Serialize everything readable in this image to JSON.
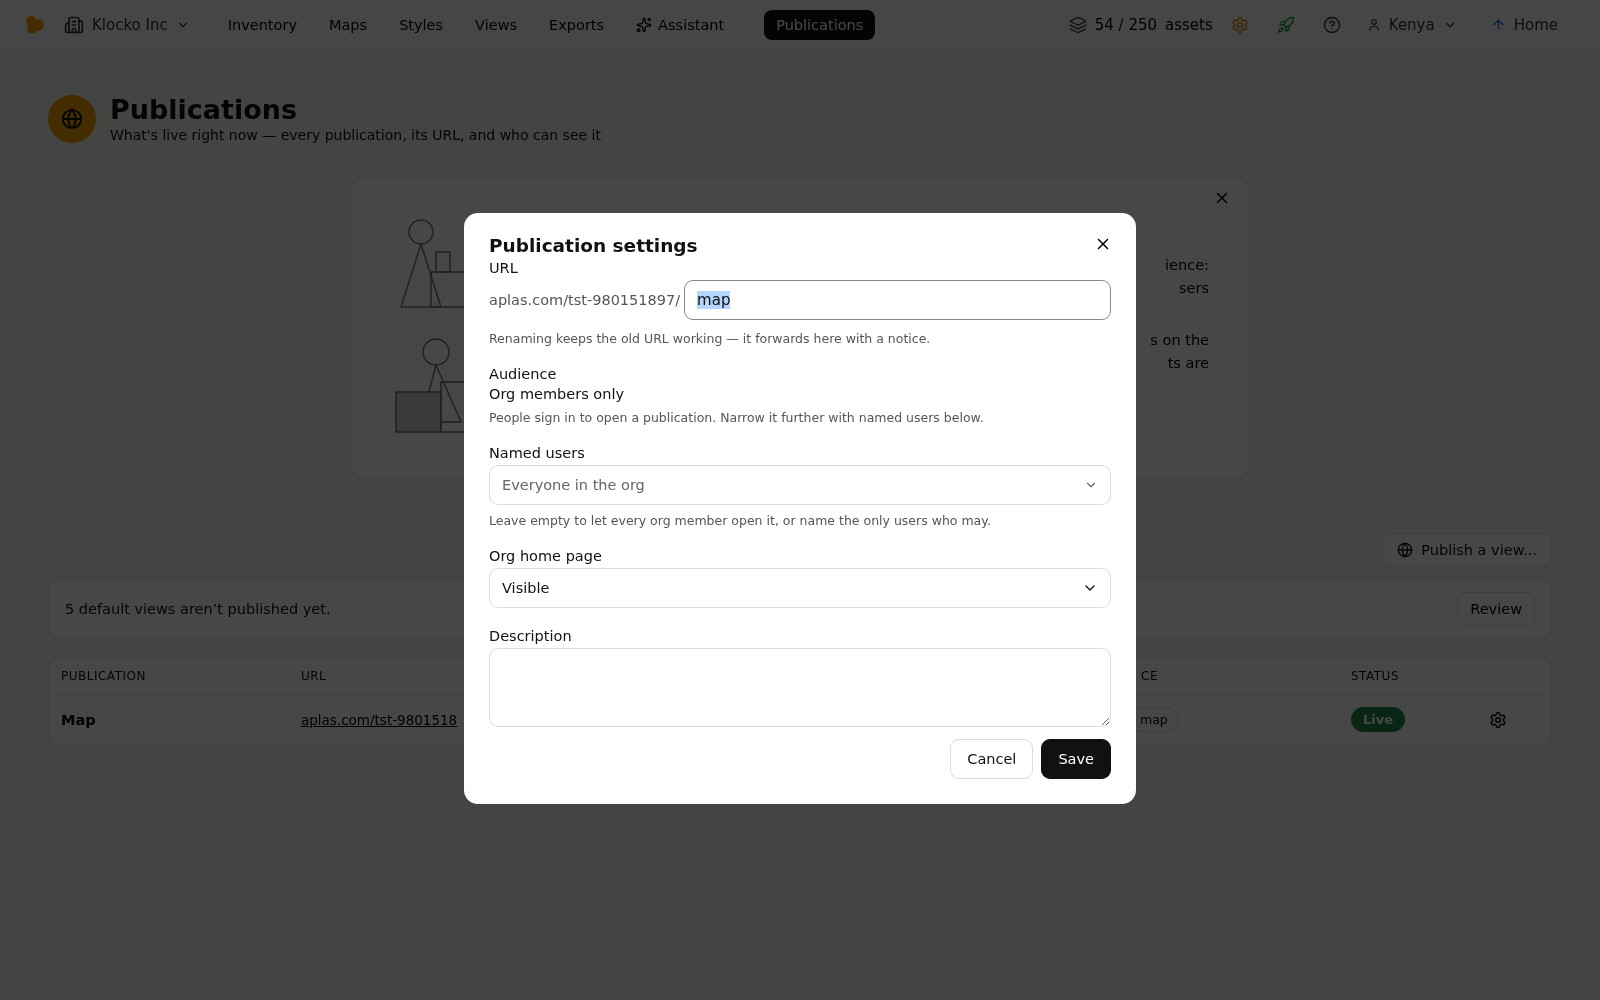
{
  "nav": {
    "org": "Klocko Inc",
    "links": [
      {
        "label": "Inventory",
        "kind": "plain",
        "selected": false
      },
      {
        "label": "Maps",
        "kind": "plain",
        "selected": false
      },
      {
        "label": "Styles",
        "kind": "plain",
        "selected": false
      },
      {
        "label": "Views",
        "kind": "plain",
        "selected": false
      },
      {
        "label": "Exports",
        "kind": "plain",
        "selected": false
      },
      {
        "label": "Assistant",
        "kind": "ai",
        "selected": false
      },
      {
        "label": "Publications",
        "kind": "plain",
        "selected": true
      }
    ],
    "assets_count": "54 / 250",
    "assets_label": "assets",
    "user": "Kenya",
    "home": "Home"
  },
  "header": {
    "title": "Publications",
    "subtitle": "What's live right now — every publication, its URL, and who can see it"
  },
  "info_card": {
    "lines": [
      "ience:",
      "sers",
      "s on the",
      "ts are"
    ]
  },
  "publish_button": "Publish a view...",
  "banner": {
    "text": "5 default views aren’t published yet.",
    "button": "Review"
  },
  "table": {
    "columns": [
      "PUBLICATION",
      "URL",
      "CE",
      "STATUS"
    ],
    "rows": [
      {
        "publication": "Map",
        "url": "aplas.com/tst-9801518",
        "column_4": "map",
        "status": "Live"
      }
    ]
  },
  "dialog": {
    "title": "Publication settings",
    "url_label": "URL",
    "url_prefix": "aplas.com/tst-980151897/",
    "url_value": "map",
    "url_value_selected": true,
    "url_hint": "Renaming keeps the old URL working — it forwards here with a notice.",
    "audience_label": "Audience",
    "audience_value": "Org members only",
    "audience_hint": "People sign in to open a publication. Narrow it further with named users below.",
    "named_users_label": "Named users",
    "named_users_placeholder": "Everyone in the org",
    "named_users_hint": "Leave empty to let every org member open it, or name the only users who may.",
    "home_label": "Org home page",
    "home_value": "Visible",
    "description_label": "Description",
    "buttons": [
      {
        "label": "Cancel",
        "kind": "secondary"
      },
      {
        "label": "Save",
        "kind": "primary"
      }
    ]
  }
}
